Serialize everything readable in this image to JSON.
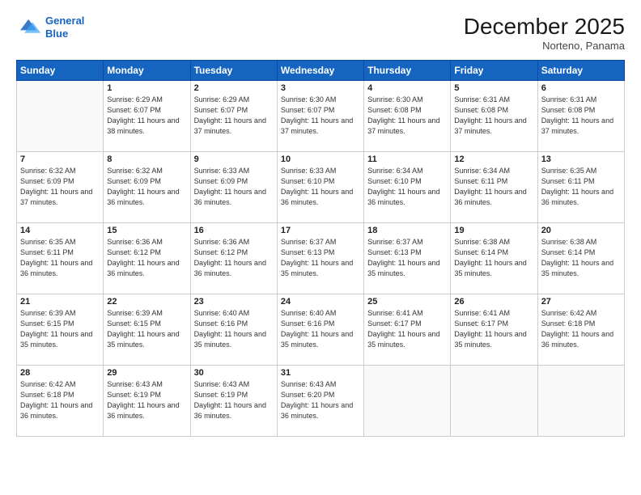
{
  "header": {
    "logo_line1": "General",
    "logo_line2": "Blue",
    "main_title": "December 2025",
    "subtitle": "Norteno, Panama"
  },
  "weekdays": [
    "Sunday",
    "Monday",
    "Tuesday",
    "Wednesday",
    "Thursday",
    "Friday",
    "Saturday"
  ],
  "weeks": [
    [
      {
        "day": "",
        "empty": true
      },
      {
        "day": "1",
        "sunrise": "6:29 AM",
        "sunset": "6:07 PM",
        "daylight": "11 hours and 38 minutes."
      },
      {
        "day": "2",
        "sunrise": "6:29 AM",
        "sunset": "6:07 PM",
        "daylight": "11 hours and 37 minutes."
      },
      {
        "day": "3",
        "sunrise": "6:30 AM",
        "sunset": "6:07 PM",
        "daylight": "11 hours and 37 minutes."
      },
      {
        "day": "4",
        "sunrise": "6:30 AM",
        "sunset": "6:08 PM",
        "daylight": "11 hours and 37 minutes."
      },
      {
        "day": "5",
        "sunrise": "6:31 AM",
        "sunset": "6:08 PM",
        "daylight": "11 hours and 37 minutes."
      },
      {
        "day": "6",
        "sunrise": "6:31 AM",
        "sunset": "6:08 PM",
        "daylight": "11 hours and 37 minutes."
      }
    ],
    [
      {
        "day": "7",
        "sunrise": "6:32 AM",
        "sunset": "6:09 PM",
        "daylight": "11 hours and 37 minutes."
      },
      {
        "day": "8",
        "sunrise": "6:32 AM",
        "sunset": "6:09 PM",
        "daylight": "11 hours and 36 minutes."
      },
      {
        "day": "9",
        "sunrise": "6:33 AM",
        "sunset": "6:09 PM",
        "daylight": "11 hours and 36 minutes."
      },
      {
        "day": "10",
        "sunrise": "6:33 AM",
        "sunset": "6:10 PM",
        "daylight": "11 hours and 36 minutes."
      },
      {
        "day": "11",
        "sunrise": "6:34 AM",
        "sunset": "6:10 PM",
        "daylight": "11 hours and 36 minutes."
      },
      {
        "day": "12",
        "sunrise": "6:34 AM",
        "sunset": "6:11 PM",
        "daylight": "11 hours and 36 minutes."
      },
      {
        "day": "13",
        "sunrise": "6:35 AM",
        "sunset": "6:11 PM",
        "daylight": "11 hours and 36 minutes."
      }
    ],
    [
      {
        "day": "14",
        "sunrise": "6:35 AM",
        "sunset": "6:11 PM",
        "daylight": "11 hours and 36 minutes."
      },
      {
        "day": "15",
        "sunrise": "6:36 AM",
        "sunset": "6:12 PM",
        "daylight": "11 hours and 36 minutes."
      },
      {
        "day": "16",
        "sunrise": "6:36 AM",
        "sunset": "6:12 PM",
        "daylight": "11 hours and 36 minutes."
      },
      {
        "day": "17",
        "sunrise": "6:37 AM",
        "sunset": "6:13 PM",
        "daylight": "11 hours and 35 minutes."
      },
      {
        "day": "18",
        "sunrise": "6:37 AM",
        "sunset": "6:13 PM",
        "daylight": "11 hours and 35 minutes."
      },
      {
        "day": "19",
        "sunrise": "6:38 AM",
        "sunset": "6:14 PM",
        "daylight": "11 hours and 35 minutes."
      },
      {
        "day": "20",
        "sunrise": "6:38 AM",
        "sunset": "6:14 PM",
        "daylight": "11 hours and 35 minutes."
      }
    ],
    [
      {
        "day": "21",
        "sunrise": "6:39 AM",
        "sunset": "6:15 PM",
        "daylight": "11 hours and 35 minutes."
      },
      {
        "day": "22",
        "sunrise": "6:39 AM",
        "sunset": "6:15 PM",
        "daylight": "11 hours and 35 minutes."
      },
      {
        "day": "23",
        "sunrise": "6:40 AM",
        "sunset": "6:16 PM",
        "daylight": "11 hours and 35 minutes."
      },
      {
        "day": "24",
        "sunrise": "6:40 AM",
        "sunset": "6:16 PM",
        "daylight": "11 hours and 35 minutes."
      },
      {
        "day": "25",
        "sunrise": "6:41 AM",
        "sunset": "6:17 PM",
        "daylight": "11 hours and 35 minutes."
      },
      {
        "day": "26",
        "sunrise": "6:41 AM",
        "sunset": "6:17 PM",
        "daylight": "11 hours and 35 minutes."
      },
      {
        "day": "27",
        "sunrise": "6:42 AM",
        "sunset": "6:18 PM",
        "daylight": "11 hours and 36 minutes."
      }
    ],
    [
      {
        "day": "28",
        "sunrise": "6:42 AM",
        "sunset": "6:18 PM",
        "daylight": "11 hours and 36 minutes."
      },
      {
        "day": "29",
        "sunrise": "6:43 AM",
        "sunset": "6:19 PM",
        "daylight": "11 hours and 36 minutes."
      },
      {
        "day": "30",
        "sunrise": "6:43 AM",
        "sunset": "6:19 PM",
        "daylight": "11 hours and 36 minutes."
      },
      {
        "day": "31",
        "sunrise": "6:43 AM",
        "sunset": "6:20 PM",
        "daylight": "11 hours and 36 minutes."
      },
      {
        "day": "",
        "empty": true
      },
      {
        "day": "",
        "empty": true
      },
      {
        "day": "",
        "empty": true
      }
    ]
  ]
}
